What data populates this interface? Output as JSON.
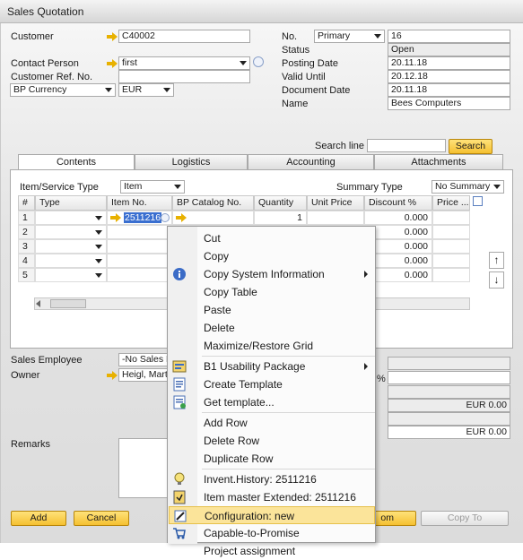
{
  "window": {
    "title": "Sales Quotation"
  },
  "header_left": {
    "customer_label": "Customer",
    "customer_value": "C40002",
    "contact_label": "Contact Person",
    "contact_value": "first",
    "ref_label": "Customer Ref. No.",
    "ref_value": "",
    "currency_label": "BP Currency",
    "currency_value": "EUR"
  },
  "header_right": {
    "no_label": "No.",
    "no_series": "Primary",
    "no_value": "16",
    "status_label": "Status",
    "status_value": "Open",
    "posting_label": "Posting Date",
    "posting_value": "20.11.18",
    "valid_label": "Valid Until",
    "valid_value": "20.12.18",
    "docdate_label": "Document Date",
    "docdate_value": "20.11.18",
    "name_label": "Name",
    "name_value": "Bees Computers"
  },
  "search": {
    "label": "Search line",
    "button": "Search"
  },
  "tabs": [
    "Contents",
    "Logistics",
    "Accounting",
    "Attachments"
  ],
  "contents": {
    "item_type_label": "Item/Service Type",
    "item_type_value": "Item",
    "summary_label": "Summary Type",
    "summary_value": "No Summary",
    "columns": [
      "#",
      "Type",
      "Item No.",
      "BP Catalog No.",
      "Quantity",
      "Unit Price",
      "Discount %",
      "Price ..."
    ],
    "rows": [
      {
        "n": "1",
        "item": "2511216",
        "qty": "1",
        "disc": "0.000"
      },
      {
        "n": "2",
        "item": "",
        "qty": "",
        "disc": "0.000"
      },
      {
        "n": "3",
        "item": "",
        "qty": "",
        "disc": "0.000"
      },
      {
        "n": "4",
        "item": "",
        "qty": "",
        "disc": "0.000"
      },
      {
        "n": "5",
        "item": "",
        "qty": "",
        "disc": "0.000"
      }
    ]
  },
  "footer": {
    "sales_employee_label": "Sales Employee",
    "sales_employee_value": "-No Sales E",
    "owner_label": "Owner",
    "owner_value": "Heigl, Mart",
    "remarks_label": "Remarks",
    "pct_symbol": "%",
    "total1": "EUR 0.00",
    "total2": "EUR 0.00"
  },
  "buttons": {
    "add": "Add",
    "cancel": "Cancel",
    "copy_from": "om",
    "copy_to": "Copy To"
  },
  "context_menu": [
    {
      "label": "Cut",
      "icon": ""
    },
    {
      "label": "Copy",
      "icon": ""
    },
    {
      "label": "Copy System Information",
      "icon": "info-icon",
      "submenu": true
    },
    {
      "label": "Copy Table",
      "icon": ""
    },
    {
      "label": "Paste",
      "icon": ""
    },
    {
      "label": "Delete",
      "icon": ""
    },
    {
      "label": "Maximize/Restore Grid",
      "icon": ""
    },
    {
      "label": "B1 Usability Package",
      "icon": "usability-icon",
      "submenu": true
    },
    {
      "label": "Create Template",
      "icon": "template-icon"
    },
    {
      "label": "Get template...",
      "icon": "get-template-icon"
    },
    {
      "label": "Add Row",
      "icon": ""
    },
    {
      "label": "Delete Row",
      "icon": ""
    },
    {
      "label": "Duplicate Row",
      "icon": ""
    },
    {
      "label": "Invent.History: 2511216",
      "icon": "bulb-icon"
    },
    {
      "label": "Item master Extended: 2511216",
      "icon": "doc-icon"
    },
    {
      "label": "Configuration: new",
      "icon": "wrench-icon",
      "highlighted": true
    },
    {
      "label": "Capable-to-Promise",
      "icon": "cart-icon"
    },
    {
      "label": "Project assignment",
      "icon": ""
    }
  ]
}
